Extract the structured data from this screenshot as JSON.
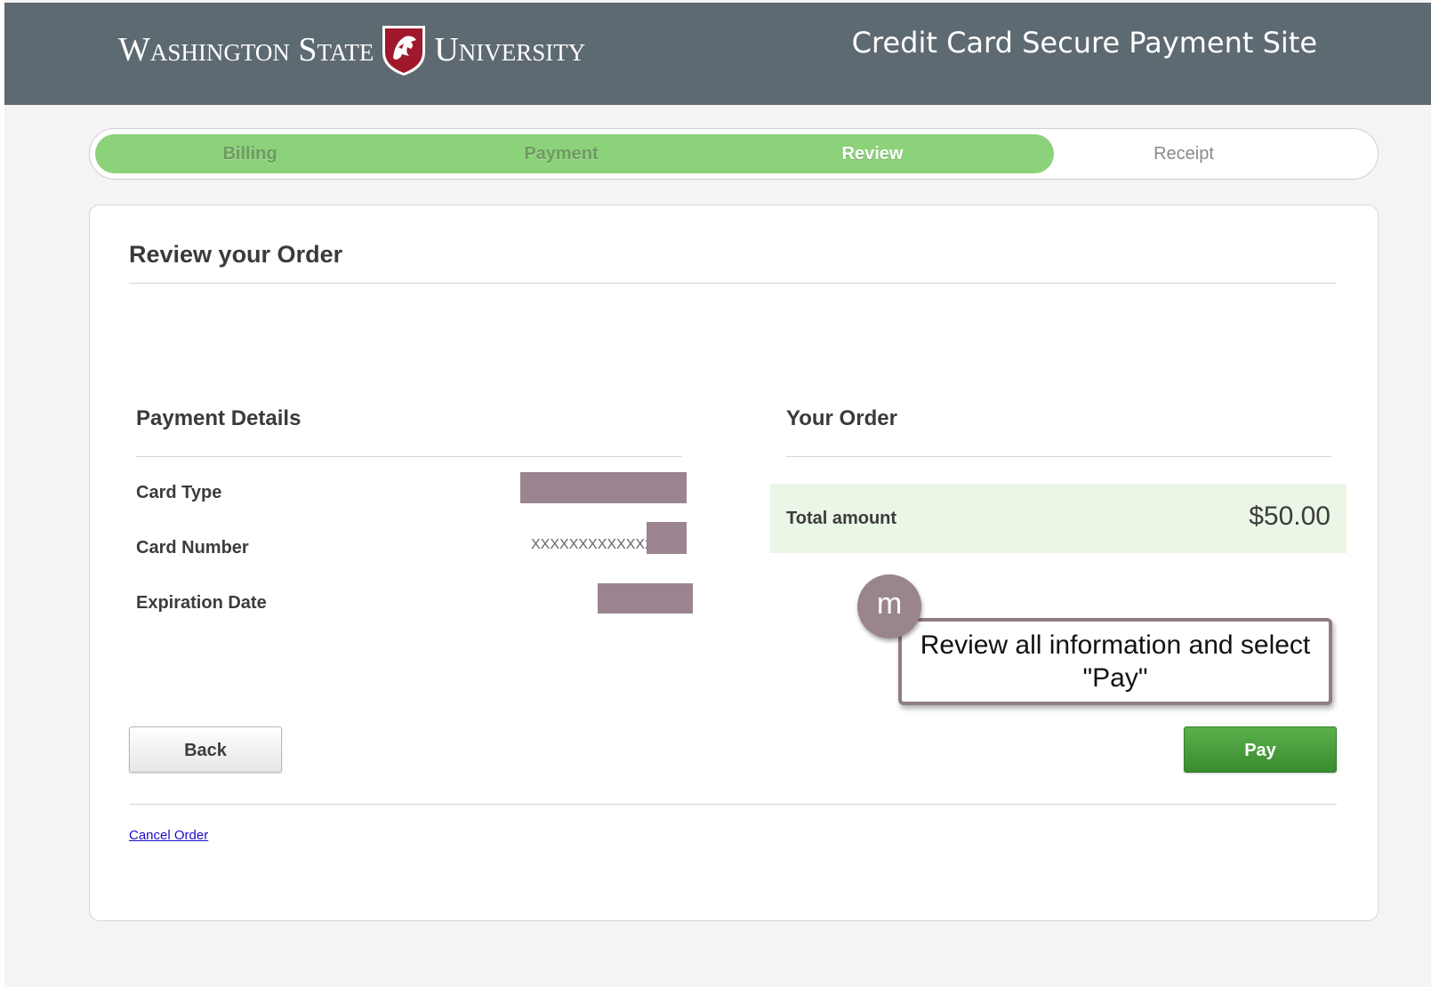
{
  "header": {
    "logo_part1": "Washington State",
    "logo_part2": "University",
    "site_title": "Credit Card Secure Payment Site",
    "bg_color": "#5e6a71"
  },
  "progress": {
    "steps": [
      {
        "label": "Billing",
        "state": "done"
      },
      {
        "label": "Payment",
        "state": "done"
      },
      {
        "label": "Review",
        "state": "active"
      },
      {
        "label": "Receipt",
        "state": "todo"
      }
    ],
    "fill_color": "#8cd27a"
  },
  "review": {
    "title": "Review your Order",
    "payment_details": {
      "title": "Payment Details",
      "rows": [
        {
          "label": "Card Type",
          "value": ""
        },
        {
          "label": "Card Number",
          "value": "XXXXXXXXXXXX2"
        },
        {
          "label": "Expiration Date",
          "value": ""
        }
      ]
    },
    "your_order": {
      "title": "Your Order",
      "total_label": "Total amount",
      "total_value": "$50.00"
    },
    "back_label": "Back",
    "pay_label": "Pay",
    "cancel_label": "Cancel Order"
  },
  "callout": {
    "badge": "m",
    "text": "Review all information and select \"Pay\""
  },
  "colors": {
    "pay_button": "#46a03a",
    "redaction": "#9b8490",
    "total_bg": "#eaf6e6"
  }
}
